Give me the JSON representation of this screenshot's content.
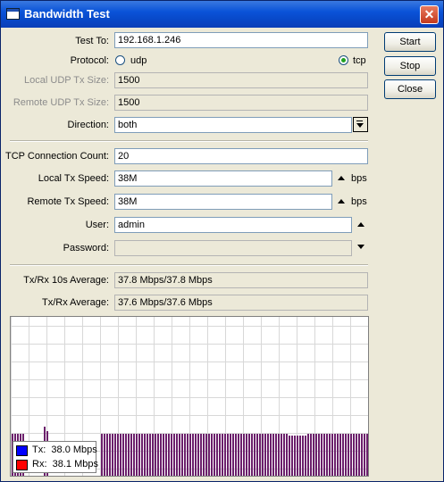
{
  "window": {
    "title": "Bandwidth Test"
  },
  "buttons": {
    "start": "Start",
    "stop": "Stop",
    "close": "Close"
  },
  "form": {
    "test_to": {
      "label": "Test To:",
      "value": "192.168.1.246"
    },
    "protocol": {
      "label": "Protocol:",
      "options": [
        "udp",
        "tcp"
      ],
      "selected": "tcp"
    },
    "local_udp_tx_size": {
      "label": "Local UDP Tx Size:",
      "value": "1500"
    },
    "remote_udp_tx_size": {
      "label": "Remote UDP Tx Size:",
      "value": "1500"
    },
    "direction": {
      "label": "Direction:",
      "value": "both"
    },
    "tcp_connection_count": {
      "label": "TCP Connection Count:",
      "value": "20"
    },
    "local_tx_speed": {
      "label": "Local Tx Speed:",
      "value": "38M",
      "unit": "bps"
    },
    "remote_tx_speed": {
      "label": "Remote Tx Speed:",
      "value": "38M",
      "unit": "bps"
    },
    "user": {
      "label": "User:",
      "value": "admin"
    },
    "password": {
      "label": "Password:",
      "value": ""
    }
  },
  "stats": {
    "avg_10s": {
      "label": "Tx/Rx 10s Average:",
      "value": "37.8 Mbps/37.8 Mbps"
    },
    "avg": {
      "label": "Tx/Rx Average:",
      "value": "37.6 Mbps/37.6 Mbps"
    }
  },
  "graph": {
    "legend": [
      {
        "name": "Tx:",
        "value": "38.0 Mbps",
        "color": "#0000ff"
      },
      {
        "name": "Rx:",
        "value": "38.1 Mbps",
        "color": "#ff0000"
      }
    ],
    "bar_color": "#6b1f6b"
  }
}
